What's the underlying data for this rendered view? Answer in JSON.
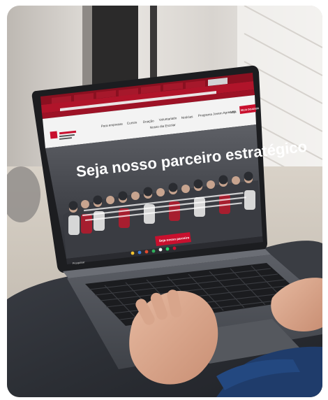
{
  "photo": {
    "subject": "laptop-on-lap",
    "screen": {
      "browser": {
        "accent": "#c8102e",
        "tab_count": 9
      },
      "site": {
        "nav_items": [
          "Para empresas",
          "Cursos",
          "Doação",
          "Voluntariado",
          "Notícias",
          "Programa Jovem Aprendiz",
          "Loja"
        ],
        "nav_items_row2": [
          "Nosso dia Escolar"
        ],
        "cta_top": "SEJA DOADOR",
        "hero_title": "Seja nosso parceiro estratégico",
        "cta_button": "Seja nosso parceiro",
        "brand_color": "#c8102e"
      },
      "taskbar": {
        "search": "Pesquisar"
      }
    }
  }
}
